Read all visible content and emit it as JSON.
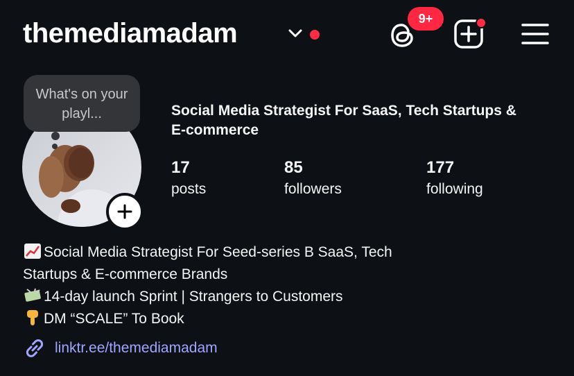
{
  "header": {
    "username": "themediamadam",
    "threads_badge": "9+"
  },
  "profile": {
    "note": "What's on your playl...",
    "category": "Social Media Strategist For SaaS, Tech Startups & E-commerce",
    "stats": [
      {
        "value": "17",
        "label": "posts"
      },
      {
        "value": "85",
        "label": "followers"
      },
      {
        "value": "177",
        "label": "following"
      }
    ]
  },
  "bio": {
    "line1": "Social Media Strategist For Seed-series B SaaS, Tech",
    "line2": "Startups & E-commerce Brands",
    "line3": "14-day launch Sprint | Strangers to Customers",
    "line4": "DM “SCALE” To Book"
  },
  "link": {
    "url": "linktr.ee/themediamadam"
  },
  "colors": {
    "background": "#0d1014",
    "badge": "#ff2741",
    "link": "#a0a6ff"
  },
  "icons": [
    "chevron-down-icon",
    "threads-icon",
    "create-post-icon",
    "menu-icon",
    "add-story-icon",
    "chart-emoji-icon",
    "money-emoji-icon",
    "pointing-down-emoji-icon",
    "link-icon"
  ]
}
